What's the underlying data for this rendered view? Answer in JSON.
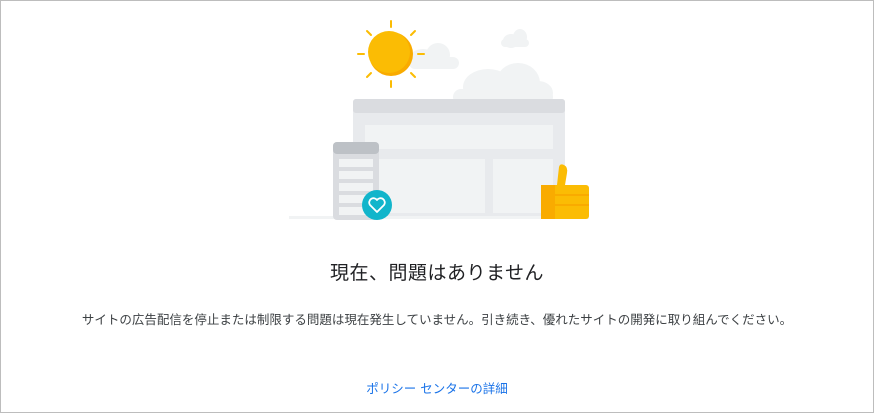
{
  "status": {
    "title": "現在、問題はありません",
    "description": "サイトの広告配信を停止または制限する問題は現在発生していません。引き続き、優れたサイトの開発に取り組んでください。",
    "link_label": "ポリシー センターの詳細"
  },
  "illustration": {
    "icons": [
      "sun-icon",
      "cloud-icon",
      "browser-window-icon",
      "phone-icon",
      "heart-icon",
      "thumbs-up-icon"
    ],
    "colors": {
      "sun": "#FBBC04",
      "sun_shadow": "#F9AB00",
      "cloud": "#F1F3F4",
      "window": "#E8EAED",
      "window_frame": "#DADCE0",
      "heart_badge": "#12B5CB",
      "thumb": "#FBBC04"
    }
  }
}
